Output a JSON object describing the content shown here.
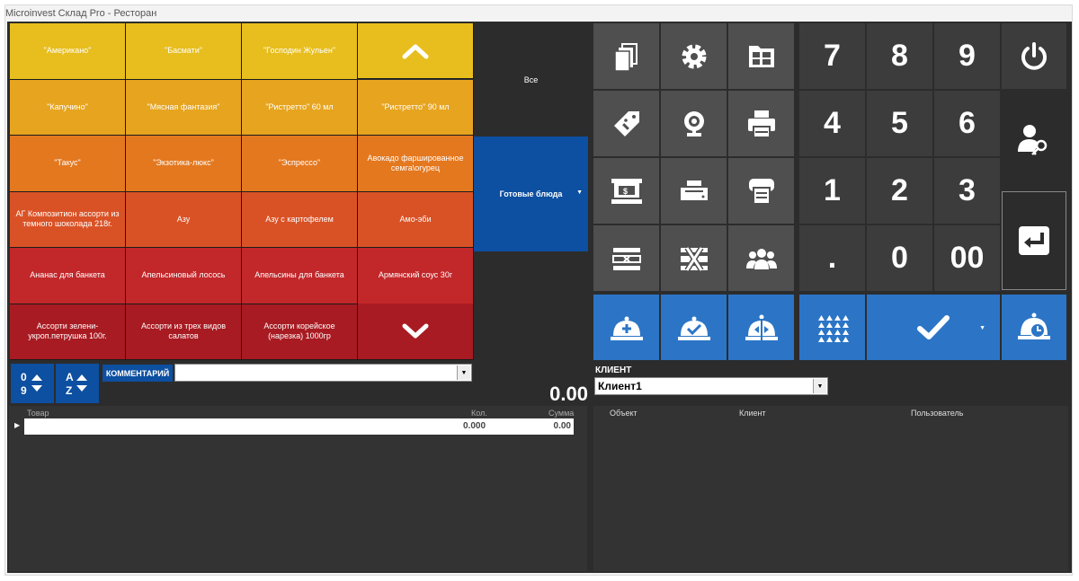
{
  "window": {
    "title": "Microinvest Склад Pro - Ресторан"
  },
  "products": [
    {
      "label": "\"Американо\"",
      "color": "#e7be1e"
    },
    {
      "label": "\"Басмати\"",
      "color": "#e7be1e"
    },
    {
      "label": "\"Господин Жульен\"",
      "color": "#e7be1e"
    },
    {
      "label": "\"Капучино\"",
      "color": "#e6a41f"
    },
    {
      "label": "\"Мясная фантазия\"",
      "color": "#e6a41f"
    },
    {
      "label": "\"Ристретто\" 60 мл",
      "color": "#e6a41f"
    },
    {
      "label": "\"Ристретто\" 90 мл",
      "color": "#e6a41f"
    },
    {
      "label": "\"Такус\"",
      "color": "#e4781f"
    },
    {
      "label": "\"Экзотика-люкс\"",
      "color": "#e4781f"
    },
    {
      "label": "\"Эспрессо\"",
      "color": "#e4781f"
    },
    {
      "label": "Авокадо фаршированное семга\\огурец",
      "color": "#e4781f"
    },
    {
      "label": "АГ Композитион ассорти из темного шоколада 218г.",
      "color": "#d95226"
    },
    {
      "label": "Азу",
      "color": "#d95226"
    },
    {
      "label": "Азу с картофелем",
      "color": "#d95226"
    },
    {
      "label": "Амо-эби",
      "color": "#d95226"
    },
    {
      "label": "Ананас для банкета",
      "color": "#c2272a"
    },
    {
      "label": "Апельсиновый лосось",
      "color": "#c2272a"
    },
    {
      "label": "Апельсины для банкета",
      "color": "#c2272a"
    },
    {
      "label": "Армянский соус 30г",
      "color": "#c2272a"
    },
    {
      "label": "Ассорти зелени-укроп.петрушка 100г.",
      "color": "#a81b22"
    },
    {
      "label": "Ассорти из трех видов салатов",
      "color": "#a81b22"
    },
    {
      "label": "Ассорти корейское (нарезка) 1000гр",
      "color": "#a81b22"
    }
  ],
  "scroll": {
    "up_color": "#e7be1e",
    "down_color": "#a81b22"
  },
  "categories": {
    "all": "Все",
    "ready": "Готовые блюда"
  },
  "comment": {
    "label": "КОММЕНТАРИЙ",
    "value": ""
  },
  "total": "0.00",
  "order_table": {
    "headers": [
      "Товар",
      "Кол.",
      "Сумма"
    ],
    "rows": [
      {
        "name": "",
        "qty": "0.000",
        "sum": "0.00"
      }
    ]
  },
  "numpad": [
    "7",
    "8",
    "9",
    "4",
    "5",
    "6",
    "1",
    "2",
    "3",
    ".",
    "0",
    "00"
  ],
  "client": {
    "label": "КЛИЕНТ",
    "value": "Клиент1"
  },
  "objects_table": {
    "headers": [
      "Объект",
      "Клиент",
      "Пользователь"
    ]
  },
  "icons": {
    "function_grid": [
      "documents-icon",
      "gear-icon",
      "file-table-icon",
      "price-tag-info-icon",
      "webcam-icon",
      "printer-icon",
      "cash-register-icon",
      "receipt-printer-icon",
      "fiscal-printer-icon",
      "void-row-icon",
      "delete-row-icon",
      "group-icon"
    ],
    "power": "power-icon",
    "user_key": "user-key-icon",
    "enter": "enter-icon",
    "sort_numeric": "sort-numeric-icon",
    "sort_alpha": "sort-alpha-icon",
    "chevron_up": "chevron-up-icon",
    "chevron_down": "chevron-down-icon"
  },
  "colors": {
    "accent_blue": "#2c75c6",
    "category_blue": "#0d4fa0",
    "dark_bg": "#2c2c2c",
    "gray_button": "#4f4f4f"
  }
}
